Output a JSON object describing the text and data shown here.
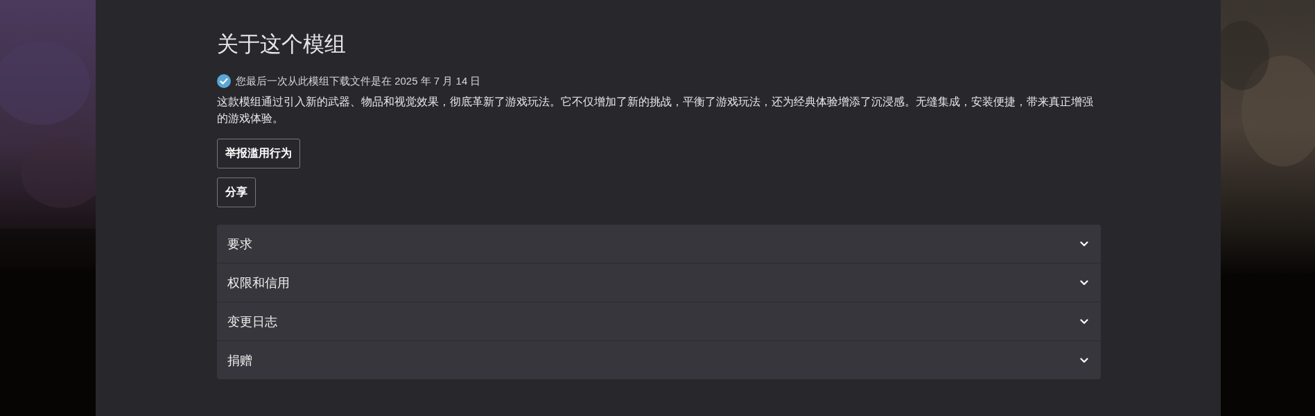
{
  "about": {
    "title": "关于这个模组",
    "download_notice": {
      "verified": true,
      "text": "您最后一次从此模组下载文件是在 2025 年 7 月 14 日"
    },
    "description": "这款模组通过引入新的武器、物品和视觉效果，彻底革新了游戏玩法。它不仅增加了新的挑战，平衡了游戏玩法，还为经典体验增添了沉浸感。无缝集成，安装便捷，带来真正增强的游戏体验。",
    "buttons": [
      "举报滥用行为",
      "分享"
    ]
  },
  "sections": [
    {
      "label": "要求",
      "expanded": false
    },
    {
      "label": "权限和信用",
      "expanded": false
    },
    {
      "label": "变更日志",
      "expanded": false
    },
    {
      "label": "捐赠",
      "expanded": false
    }
  ]
}
